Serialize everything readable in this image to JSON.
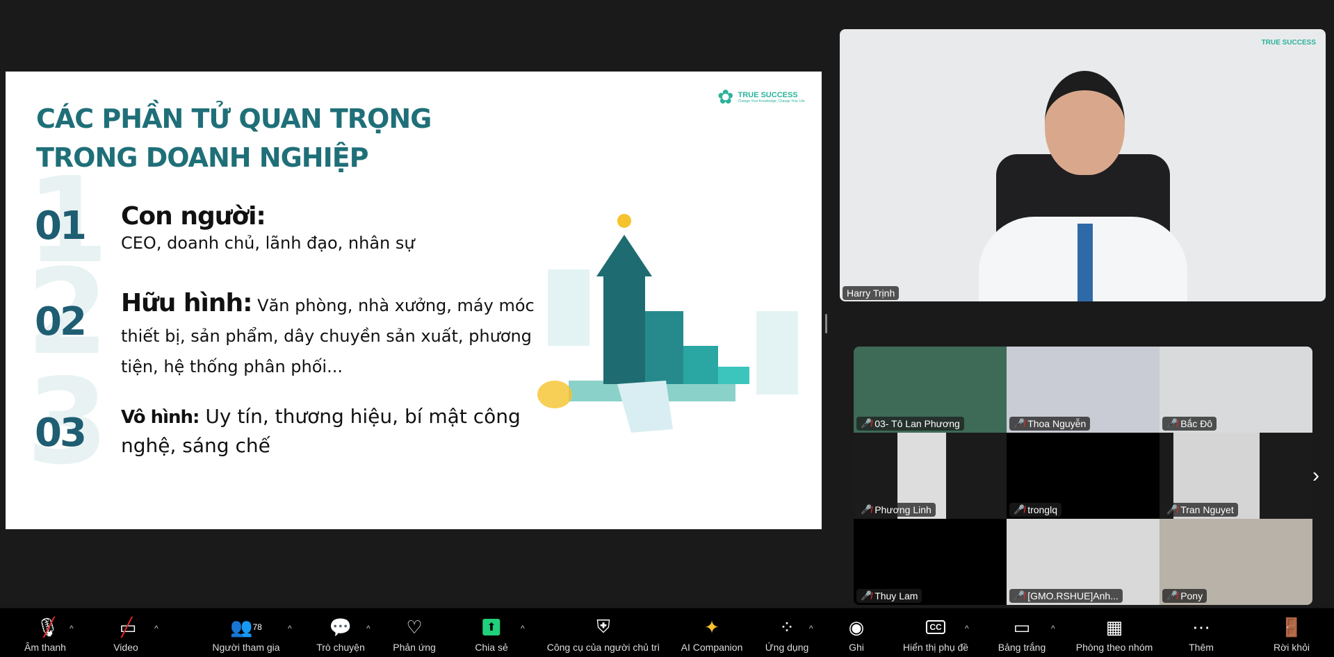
{
  "slide": {
    "logo": {
      "name": "TRUE SUCCESS",
      "tagline": "Change Your Knowledge, Change Your Life"
    },
    "title_line1": "CÁC PHẦN TỬ QUAN TRỌNG",
    "title_line2": "TRONG DOANH NGHIỆP",
    "items": [
      {
        "num": "01",
        "ghost": "1",
        "heading": "Con người:",
        "body": "CEO, doanh chủ, lãnh đạo, nhân sự"
      },
      {
        "num": "02",
        "ghost": "2",
        "heading": "Hữu hình:",
        "body": " Văn phòng, nhà xưởng, máy móc thiết bị, sản phẩm, dây chuyền sản xuất, phương tiện, hệ thống phân phối..."
      },
      {
        "num": "03",
        "ghost": "3",
        "heading": "Vô hình:",
        "body": " Uy tín, thương hiệu, bí mật công nghệ, sáng chế"
      }
    ]
  },
  "speaker": {
    "name": "Harry Trịnh",
    "logo": "TRUE SUCCESS"
  },
  "gallery": [
    {
      "name": "03- Tô Lan Phương",
      "bg": "#3d6b57"
    },
    {
      "name": "Thoa Nguyễn",
      "bg": "#c9ccd4"
    },
    {
      "name": "Bắc Đô",
      "bg": "#d8dadb"
    },
    {
      "name": "Phương Linh",
      "bg": "#1b1b1b"
    },
    {
      "name": "tronglq",
      "bg": "#000000"
    },
    {
      "name": "Tran Nguyet",
      "bg": "#1b1b1b"
    },
    {
      "name": "Thuy Lam",
      "bg": "#000000"
    },
    {
      "name": "[GMO.RSHUE]Anh...",
      "bg": "#d9d9d9"
    },
    {
      "name": "Pony",
      "bg": "#b9b2a8"
    }
  ],
  "toolbar": {
    "audio": "Âm thanh",
    "video": "Video",
    "participants": "Người tham gia",
    "participant_count": "78",
    "chat": "Trò chuyện",
    "reactions": "Phản ứng",
    "share": "Chia sẻ",
    "host_tools": "Công cụ của người chủ trì",
    "ai": "AI Companion",
    "apps": "Ứng dụng",
    "record": "Ghi",
    "captions": "Hiển thị phụ đề",
    "whiteboard": "Bảng trắng",
    "breakout": "Phòng theo nhóm",
    "more": "Thêm",
    "leave": "Rời khỏi"
  },
  "colors": {
    "accent": "#1f6f78",
    "share_green": "#21d07a",
    "muted_red": "#e02828",
    "leave_red": "#e02828"
  }
}
